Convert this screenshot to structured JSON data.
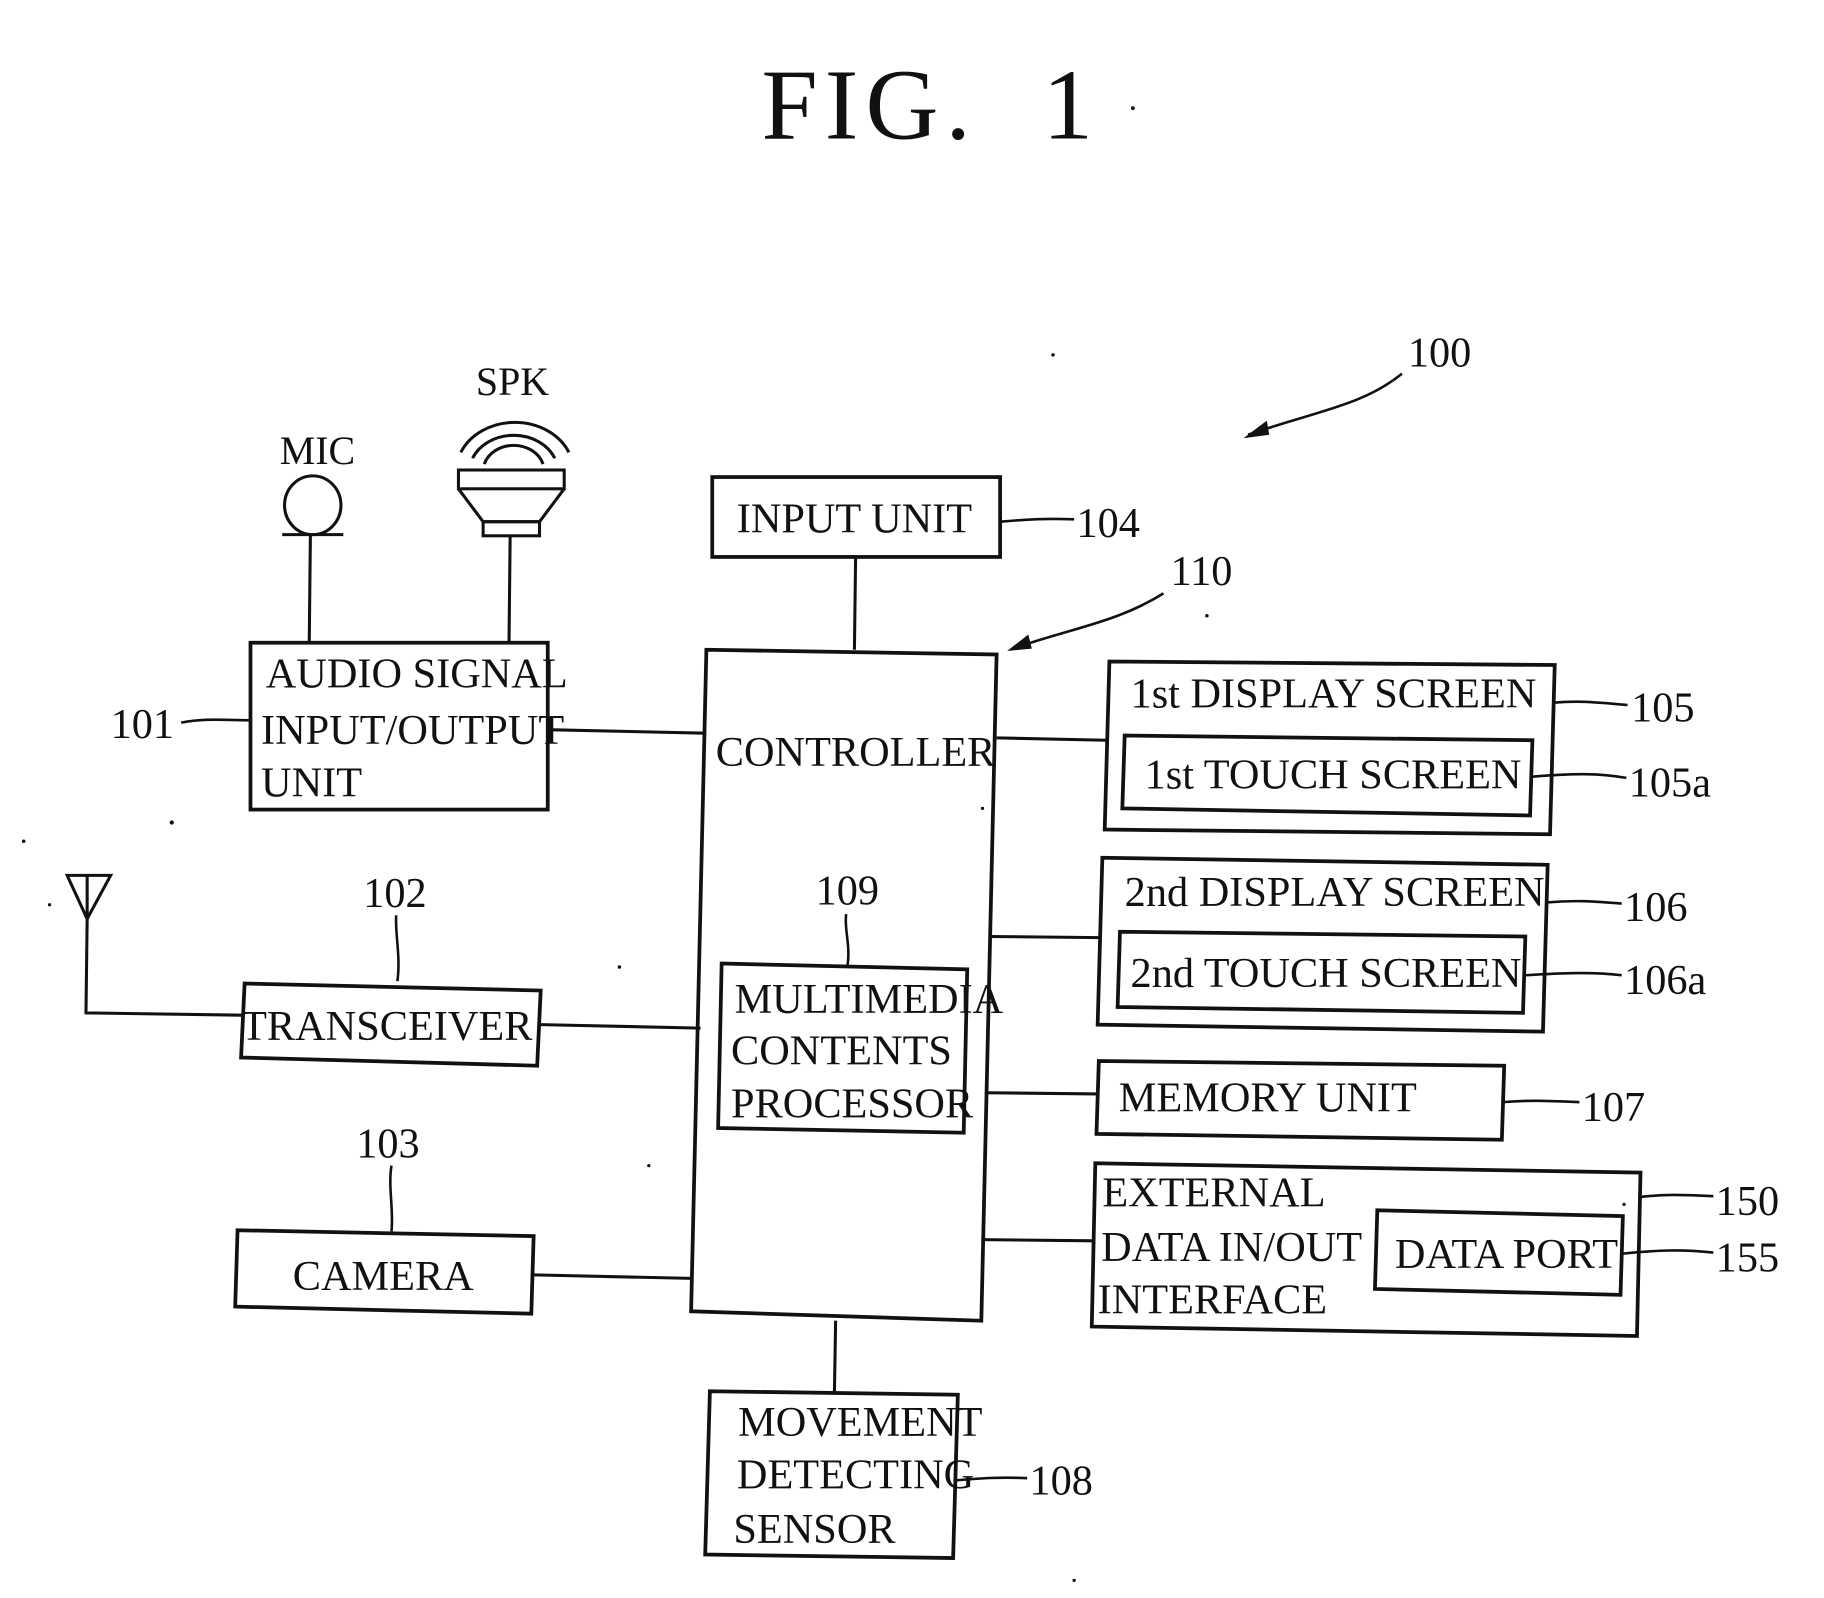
{
  "figure": {
    "title": "FIG.  1",
    "device_ref": "100"
  },
  "peripherals": {
    "mic_label": "MIC",
    "spk_label": "SPK"
  },
  "blocks": {
    "audio": {
      "lines": [
        "AUDIO SIGNAL",
        "INPUT/OUTPUT",
        "UNIT"
      ],
      "ref": "101"
    },
    "transceiver": {
      "label": "TRANSCEIVER",
      "ref": "102"
    },
    "camera": {
      "label": "CAMERA",
      "ref": "103"
    },
    "input_unit": {
      "label": "INPUT UNIT",
      "ref": "104"
    },
    "controller": {
      "label": "CONTROLLER",
      "ref": "110"
    },
    "multimedia": {
      "lines": [
        "MULTIMEDIA",
        "CONTENTS",
        "PROCESSOR"
      ],
      "ref": "109"
    },
    "movement": {
      "lines": [
        "MOVEMENT",
        "DETECTING",
        "SENSOR"
      ],
      "ref": "108"
    },
    "display1": {
      "label": "1st DISPLAY SCREEN",
      "ref": "105",
      "touch_label": "1st TOUCH SCREEN",
      "touch_ref": "105a"
    },
    "display2": {
      "label": "2nd DISPLAY SCREEN",
      "ref": "106",
      "touch_label": "2nd TOUCH SCREEN",
      "touch_ref": "106a"
    },
    "memory": {
      "label": "MEMORY UNIT",
      "ref": "107"
    },
    "external": {
      "lines": [
        "EXTERNAL",
        "DATA IN/OUT",
        "INTERFACE"
      ],
      "ref": "150",
      "port_label": "DATA PORT",
      "port_ref": "155"
    }
  }
}
